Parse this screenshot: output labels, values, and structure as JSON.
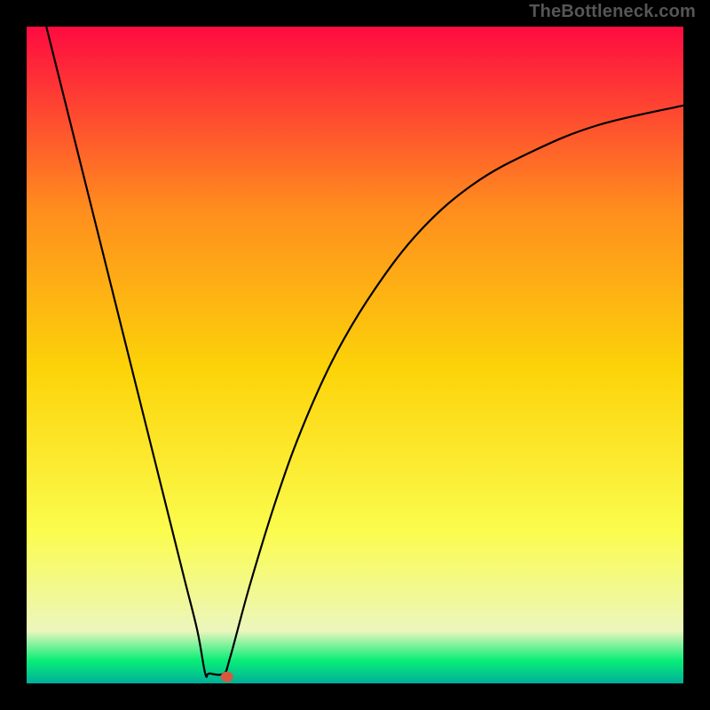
{
  "watermark": "TheBottleneck.com",
  "chart_data": {
    "type": "line",
    "title": "",
    "xlabel": "",
    "ylabel": "",
    "xlim": [
      0,
      1
    ],
    "ylim": [
      0,
      1
    ],
    "gradient_colors": {
      "top": "#fe0b40",
      "upper_mid": "#ff8e1e",
      "mid": "#fcd309",
      "lower_mid": "#fbfc4e",
      "near_bottom": "#ecf6bd",
      "bottom_band": "#09ee77",
      "very_bottom": "#00af9a"
    },
    "series": [
      {
        "name": "bottleneck-curve",
        "type": "line",
        "color": "#000000",
        "points": [
          {
            "x": 0.03,
            "y": 1.0
          },
          {
            "x": 0.06,
            "y": 0.88
          },
          {
            "x": 0.09,
            "y": 0.76
          },
          {
            "x": 0.12,
            "y": 0.64
          },
          {
            "x": 0.15,
            "y": 0.52
          },
          {
            "x": 0.18,
            "y": 0.4
          },
          {
            "x": 0.21,
            "y": 0.28
          },
          {
            "x": 0.24,
            "y": 0.16
          },
          {
            "x": 0.26,
            "y": 0.08
          },
          {
            "x": 0.272,
            "y": 0.015
          },
          {
            "x": 0.278,
            "y": 0.015
          },
          {
            "x": 0.3,
            "y": 0.015
          },
          {
            "x": 0.31,
            "y": 0.04
          },
          {
            "x": 0.34,
            "y": 0.15
          },
          {
            "x": 0.38,
            "y": 0.28
          },
          {
            "x": 0.42,
            "y": 0.39
          },
          {
            "x": 0.47,
            "y": 0.5
          },
          {
            "x": 0.53,
            "y": 0.6
          },
          {
            "x": 0.6,
            "y": 0.69
          },
          {
            "x": 0.68,
            "y": 0.76
          },
          {
            "x": 0.77,
            "y": 0.81
          },
          {
            "x": 0.87,
            "y": 0.85
          },
          {
            "x": 1.0,
            "y": 0.88
          }
        ]
      }
    ],
    "marker": {
      "name": "optimal-point",
      "x": 0.305,
      "y": 0.01,
      "color": "#d45a3f",
      "rx": 7,
      "ry": 6
    }
  }
}
